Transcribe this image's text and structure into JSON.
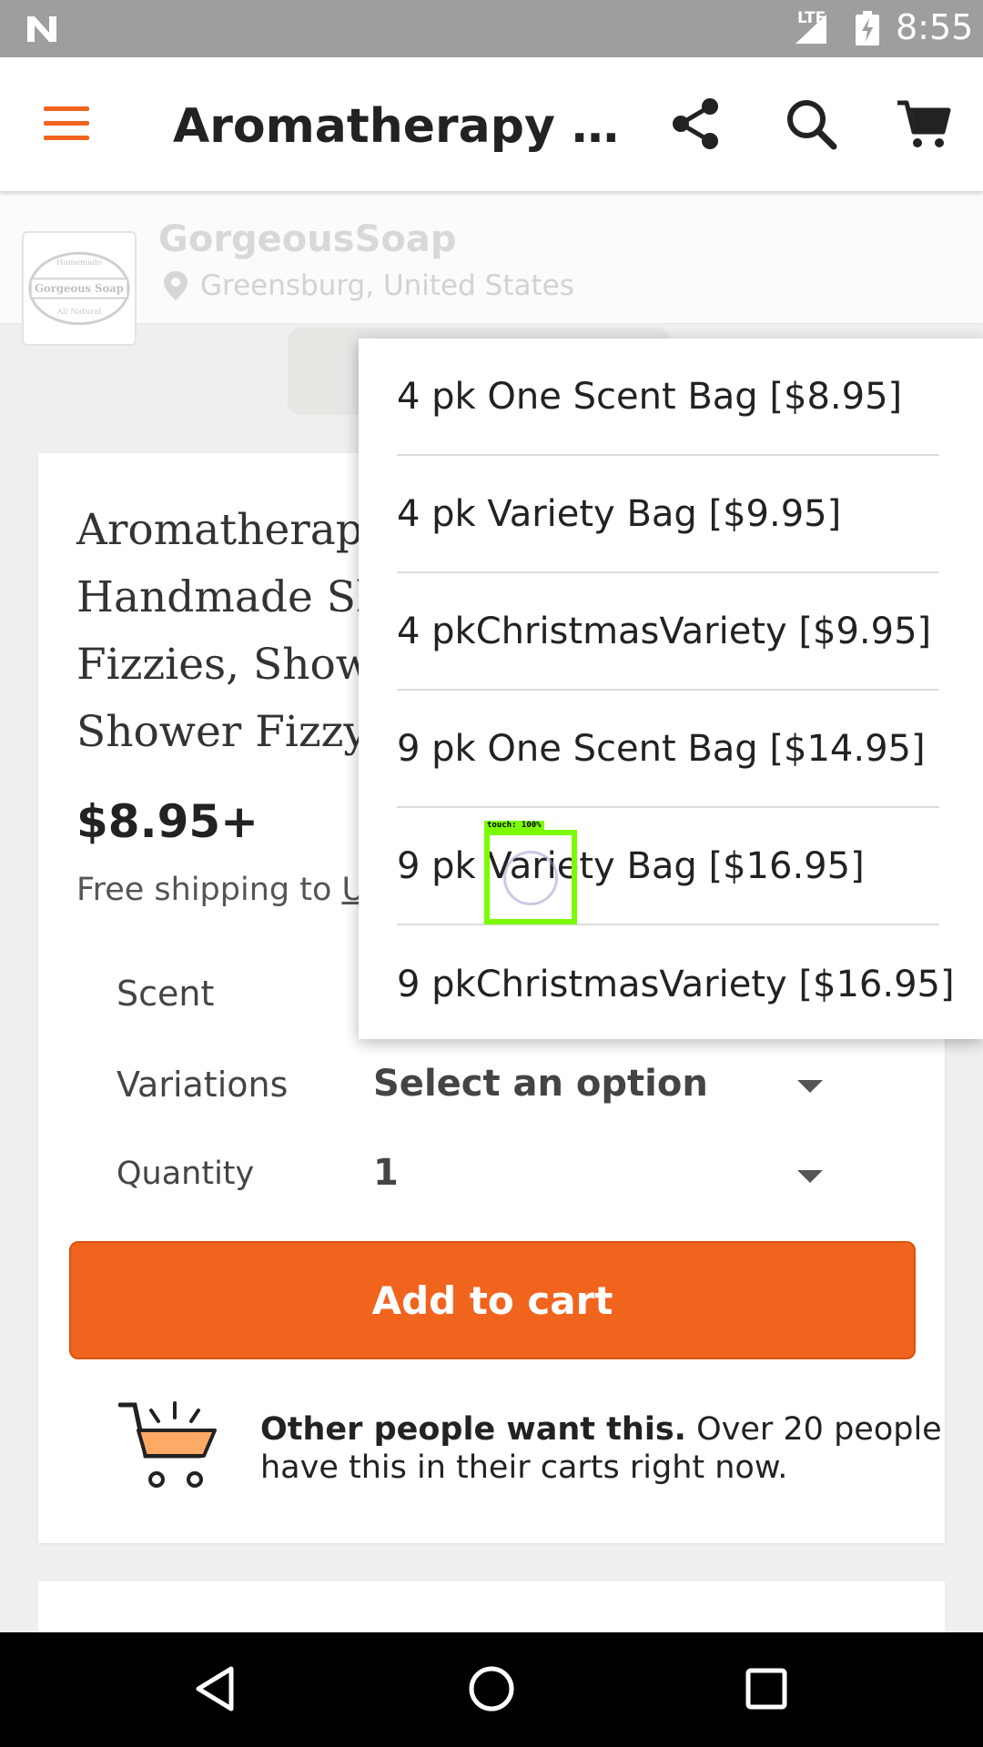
{
  "status_bar": {
    "network": "LTE",
    "time": "8:55"
  },
  "app_bar": {
    "title": "Aromatherapy Sh…",
    "icons": [
      "menu-icon",
      "share-icon",
      "search-icon",
      "cart-icon"
    ]
  },
  "shop": {
    "name": "GorgeousSoap",
    "location": "Greensburg, United States",
    "logo_text": [
      "Homemade",
      "Gorgeous Soap",
      "All Natural"
    ]
  },
  "product": {
    "title_lines": [
      "Aromatherapy",
      "Handmade Sh",
      "Fizzies, Showe",
      "Shower Fizzy"
    ],
    "price": "$8.95+",
    "shipping_prefix": "Free shipping to ",
    "shipping_link": "U"
  },
  "options": {
    "scent_label": "Scent",
    "variations_label": "Variations",
    "variations_value": "Select an option",
    "quantity_label": "Quantity",
    "quantity_value": "1"
  },
  "add_to_cart": "Add to cart",
  "social_proof": {
    "bold": "Other people want this.",
    "text": " Over 20 people have this in their carts right now."
  },
  "dropdown": {
    "options": [
      "4 pk One Scent Bag [$8.95]",
      "4 pk Variety Bag [$9.95]",
      "4 pkChristmasVariety [$9.95]",
      "9 pk One Scent Bag [$14.95]",
      "9 pk Variety Bag [$16.95]",
      "9 pkChristmasVariety [$16.95]"
    ]
  },
  "touch_overlay": {
    "label": "touch: 100%"
  },
  "colors": {
    "accent": "#f1641e",
    "touch": "#7cfc00"
  }
}
